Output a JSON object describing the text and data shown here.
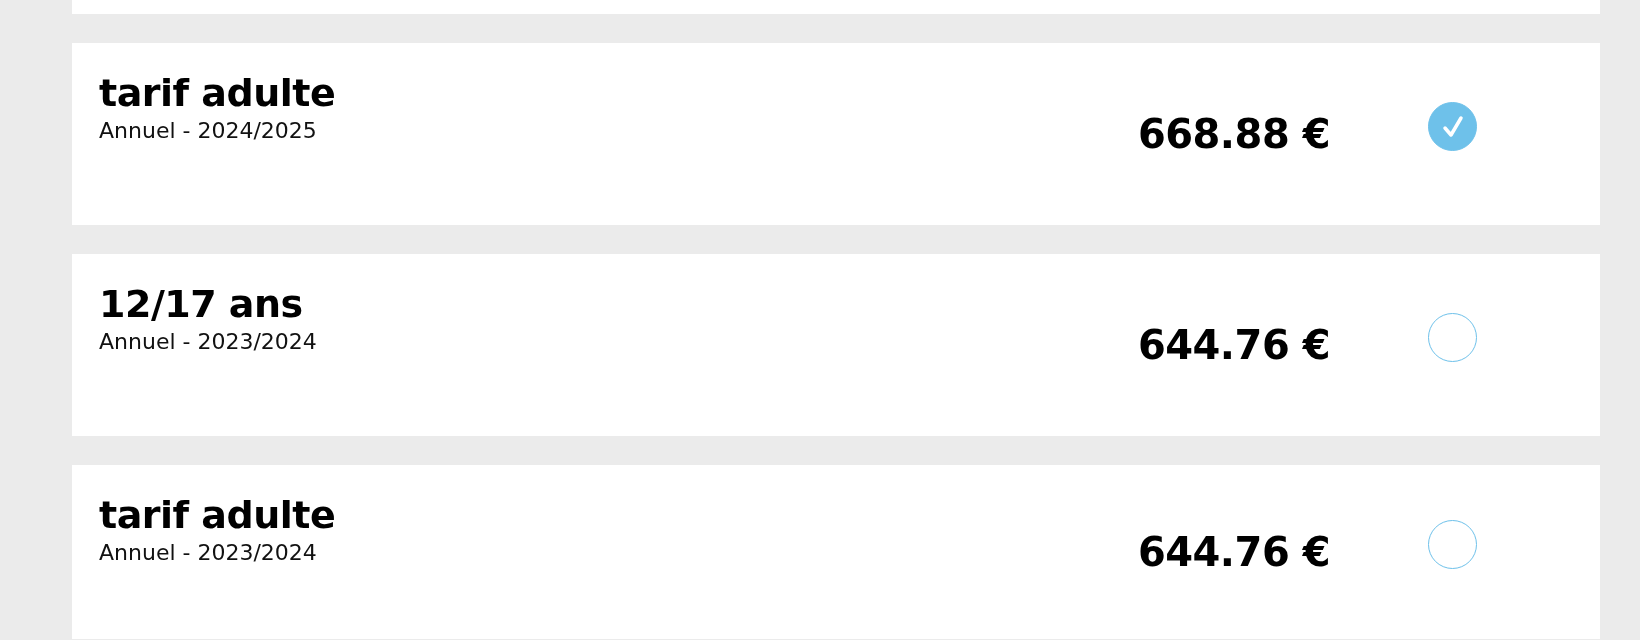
{
  "offers": [
    {
      "title": "tarif adulte",
      "subtitle": "Annuel - 2024/2025",
      "price": "668.88 €",
      "selected": true
    },
    {
      "title": "12/17 ans",
      "subtitle": "Annuel - 2023/2024",
      "price": "644.76 €",
      "selected": false
    },
    {
      "title": "tarif adulte",
      "subtitle": "Annuel - 2023/2024",
      "price": "644.76 €",
      "selected": false
    }
  ]
}
